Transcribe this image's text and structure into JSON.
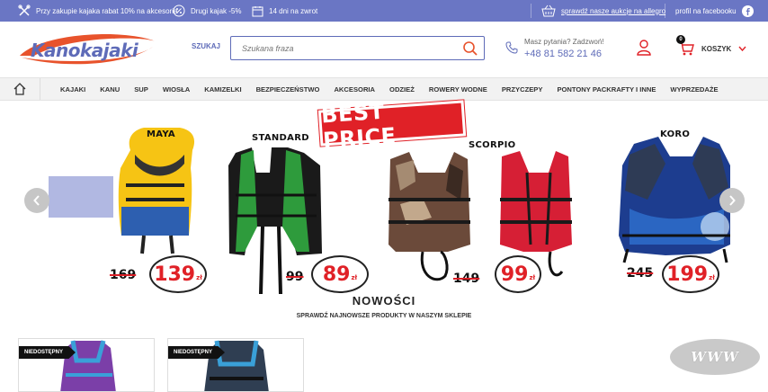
{
  "topbar": {
    "promo1": "Przy zakupie kajaka rabat 10% na akcesoria",
    "promo2": "Drugi kajak -5%",
    "promo3": "14 dni na zwrot",
    "auction_link": "sprawdź nasze aukcje na allegro",
    "facebook_link": "profil na facebooku"
  },
  "header": {
    "logo_text": "Kanokajaki",
    "search_label": "SZUKAJ",
    "search_placeholder": "Szukana fraza",
    "phone_question": "Masz pytania? Zadzwoń!",
    "phone_number": "+48 81 582 21 46",
    "cart_count": "0",
    "cart_label": "KOSZYK"
  },
  "nav": {
    "items": [
      "KAJAKI",
      "KANU",
      "SUP",
      "WIOSŁA",
      "KAMIZELKI",
      "BEZPIECZEŃSTWO",
      "AKCESORIA",
      "ODZIEŻ",
      "ROWERY WODNE",
      "PRZYCZEPY",
      "PONTONY PACKRAFTY I INNE",
      "WYPRZEDAŻE"
    ]
  },
  "banner": {
    "headline": "BEST PRICE",
    "currency": "zł",
    "products": [
      {
        "name": "MAYA",
        "old_price": "169",
        "price": "139"
      },
      {
        "name": "STANDARD",
        "old_price": "99",
        "price": "89"
      },
      {
        "name": "SCORPIO",
        "old_price": "149",
        "price": "99"
      },
      {
        "name": "KORO",
        "old_price": "245",
        "price": "199"
      }
    ]
  },
  "section": {
    "title": "NOWOŚCI",
    "subtitle": "SPRAWDŹ NAJNOWSZE PRODUKTY W NASZYM SKLEPIE"
  },
  "cards": [
    {
      "badge": "NIEDOSTĘPNY"
    },
    {
      "badge": "NIEDOSTĘPNY"
    }
  ],
  "watermark": "WWW",
  "colors": {
    "brand_blue": "#6a76c4",
    "accent_red": "#e02127",
    "nav_bg": "#f2f2f2"
  }
}
